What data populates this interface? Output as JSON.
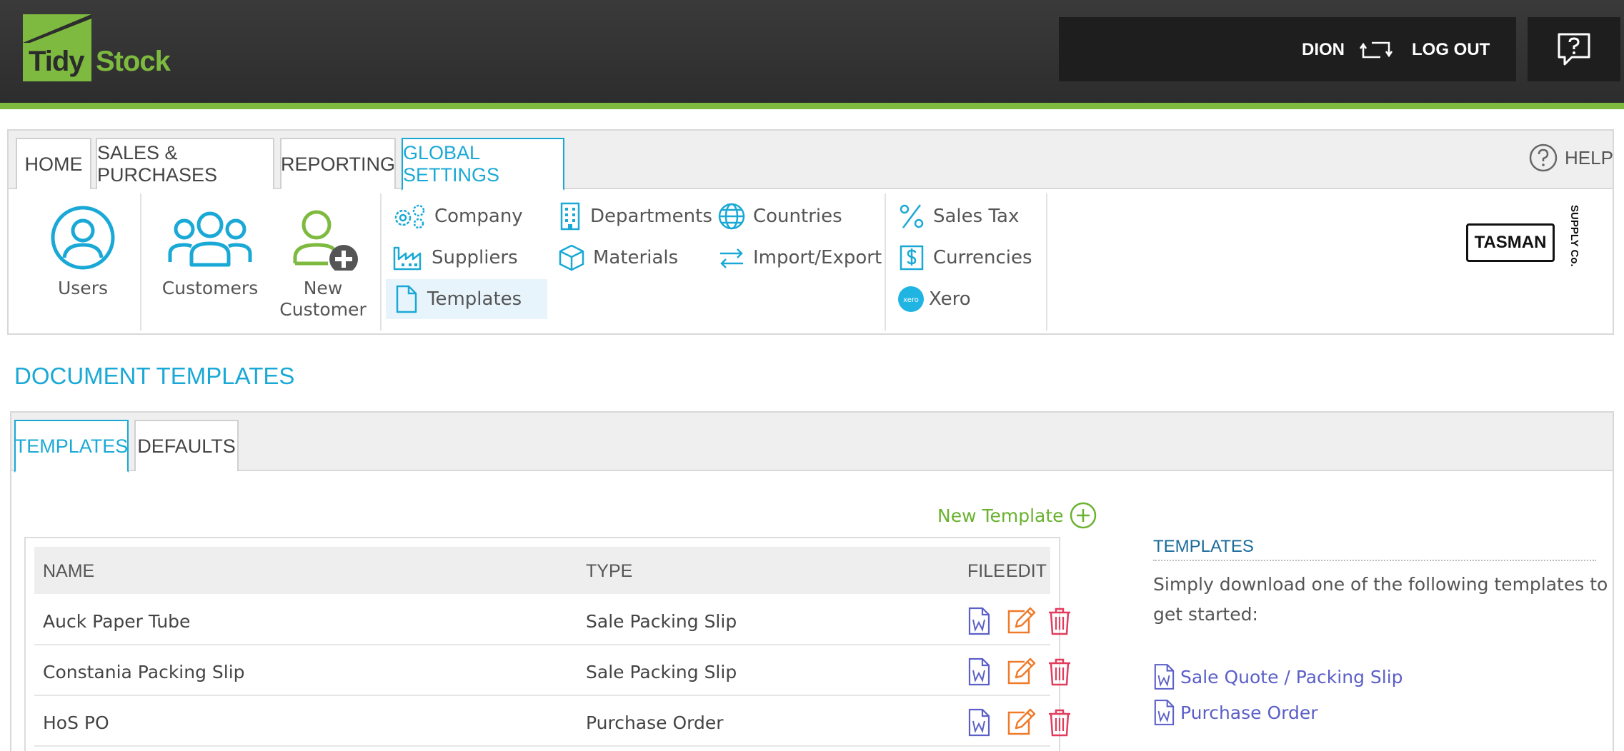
{
  "header": {
    "logo_part1": "Tidy",
    "logo_part2": "Stock",
    "user_name": "DION",
    "logout_label": "LOG OUT",
    "colors": {
      "bar": "#2d2d2d",
      "accent": "#7dba3f"
    }
  },
  "nav": {
    "tabs": [
      {
        "label": "HOME"
      },
      {
        "label": "SALES & PURCHASES"
      },
      {
        "label": "REPORTING"
      },
      {
        "label": "GLOBAL SETTINGS"
      }
    ],
    "active_tab": "GLOBAL SETTINGS",
    "help_label": "HELP",
    "quick_buttons": [
      {
        "label": "Users",
        "icon": "user-icon"
      },
      {
        "label": "Customers",
        "icon": "group-icon"
      },
      {
        "label": "New Customer",
        "line1": "New",
        "line2": "Customer",
        "icon": "add-user-icon"
      }
    ],
    "settings_items": [
      {
        "label": "Company",
        "icon": "gears-icon"
      },
      {
        "label": "Suppliers",
        "icon": "factory-icon"
      },
      {
        "label": "Templates",
        "icon": "document-icon"
      },
      {
        "label": "Departments",
        "icon": "building-icon"
      },
      {
        "label": "Materials",
        "icon": "box-icon"
      },
      {
        "label": "Countries",
        "icon": "globe-icon"
      },
      {
        "label": "Import/Export",
        "icon": "exchange-icon"
      }
    ],
    "finance_items": [
      {
        "label": "Sales Tax",
        "icon": "percent-icon"
      },
      {
        "label": "Currencies",
        "icon": "dollar-icon"
      },
      {
        "label": "Xero",
        "icon": "xero-icon",
        "badge": "xero"
      }
    ],
    "company_logo": {
      "name": "TASMAN",
      "tagline": "SUPPLY Co."
    },
    "colors": {
      "active": "#1aa9d6",
      "icon": "#1aa9d6",
      "add_user": "#7dba3f"
    }
  },
  "page": {
    "title": "DOCUMENT TEMPLATES",
    "subtabs": [
      {
        "label": "TEMPLATES"
      },
      {
        "label": "DEFAULTS"
      }
    ],
    "active_subtab": "TEMPLATES",
    "new_template_label": "New Template"
  },
  "table": {
    "columns": {
      "name": "NAME",
      "type": "TYPE",
      "file": "FILE",
      "edit": "EDIT"
    },
    "rows": [
      {
        "name": "Auck Paper Tube",
        "type": "Sale Packing Slip"
      },
      {
        "name": "Constania Packing Slip",
        "type": "Sale Packing Slip"
      },
      {
        "name": "HoS PO",
        "type": "Purchase Order"
      }
    ],
    "colors": {
      "file": "#5b5fc7",
      "edit": "#f07a2a",
      "delete": "#e23b5c"
    }
  },
  "side": {
    "title": "TEMPLATES",
    "text": "Simply download one of the following templates to get started:",
    "links": [
      {
        "label": "Sale Quote / Packing Slip"
      },
      {
        "label": "Purchase Order"
      }
    ]
  }
}
